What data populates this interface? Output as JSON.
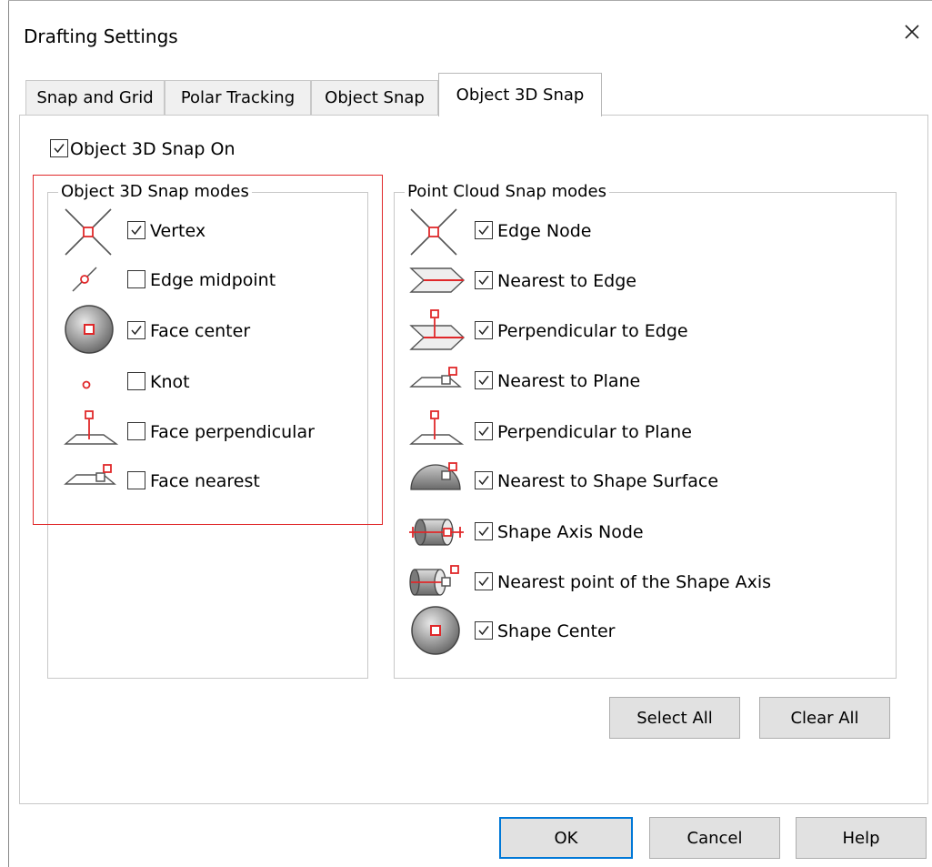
{
  "window": {
    "title": "Drafting Settings"
  },
  "tabs": [
    {
      "label": "Snap and Grid",
      "active": false
    },
    {
      "label": "Polar Tracking",
      "active": false
    },
    {
      "label": "Object Snap",
      "active": false
    },
    {
      "label": "Object 3D Snap",
      "active": true
    }
  ],
  "master": {
    "label": "Object 3D Snap On",
    "checked": true
  },
  "object_modes": {
    "title": "Object 3D Snap modes",
    "items": [
      {
        "label": "Vertex",
        "checked": true,
        "icon": "vertex-icon"
      },
      {
        "label": "Edge midpoint",
        "checked": false,
        "icon": "edge-midpoint-icon"
      },
      {
        "label": "Face center",
        "checked": true,
        "icon": "face-center-icon"
      },
      {
        "label": "Knot",
        "checked": false,
        "icon": "knot-icon"
      },
      {
        "label": "Face perpendicular",
        "checked": false,
        "icon": "face-perpendicular-icon"
      },
      {
        "label": "Face nearest",
        "checked": false,
        "icon": "face-nearest-icon"
      }
    ]
  },
  "pointcloud_modes": {
    "title": "Point Cloud Snap modes",
    "items": [
      {
        "label": "Edge Node",
        "checked": true,
        "icon": "edge-node-icon"
      },
      {
        "label": "Nearest to Edge",
        "checked": true,
        "icon": "nearest-to-edge-icon"
      },
      {
        "label": "Perpendicular to Edge",
        "checked": true,
        "icon": "perpendicular-to-edge-icon"
      },
      {
        "label": "Nearest to Plane",
        "checked": true,
        "icon": "nearest-to-plane-icon"
      },
      {
        "label": "Perpendicular to Plane",
        "checked": true,
        "icon": "perpendicular-to-plane-icon"
      },
      {
        "label": "Nearest to Shape Surface",
        "checked": true,
        "icon": "nearest-to-shape-surface-icon"
      },
      {
        "label": "Shape Axis Node",
        "checked": true,
        "icon": "shape-axis-node-icon"
      },
      {
        "label": "Nearest point of the Shape Axis",
        "checked": true,
        "icon": "nearest-point-shape-axis-icon"
      },
      {
        "label": "Shape Center",
        "checked": true,
        "icon": "shape-center-icon"
      }
    ]
  },
  "buttons": {
    "select_all": "Select All",
    "clear_all": "Clear All",
    "ok": "OK",
    "cancel": "Cancel",
    "help": "Help"
  },
  "colors": {
    "snap_marker": "#e0282a",
    "highlight_box": "#e0282a",
    "default_button_border": "#0078d7"
  }
}
